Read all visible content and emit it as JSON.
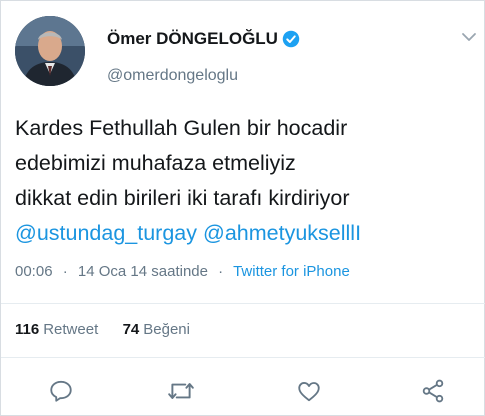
{
  "user": {
    "display_name": "Ömer DÖNGELOĞLU",
    "handle": "@omerdongeloglu",
    "verified": true
  },
  "tweet": {
    "lines": [
      "Kardes Fethullah Gulen bir hocadir",
      "edebimizi muhafaza etmeliyiz",
      "dikkat edin birileri iki tarafı kirdiriyor"
    ],
    "mentions": [
      "@ustundag_turgay",
      "@ahmetyukselllI"
    ]
  },
  "meta": {
    "time": "00:06",
    "separator": "·",
    "date": "14 Oca 14 saatinde",
    "source": "Twitter for iPhone"
  },
  "stats": {
    "retweets": "116",
    "retweets_label": "Retweet",
    "likes": "74",
    "likes_label": "Beğeni"
  },
  "icons": {
    "reply": "reply-icon",
    "retweet": "retweet-icon",
    "like": "heart-icon",
    "share": "share-icon",
    "menu": "chevron-down-icon",
    "verified": "verified-badge-icon"
  },
  "colors": {
    "link": "#1b95e0",
    "secondary_text": "#657786",
    "verified": "#1da1f2"
  }
}
